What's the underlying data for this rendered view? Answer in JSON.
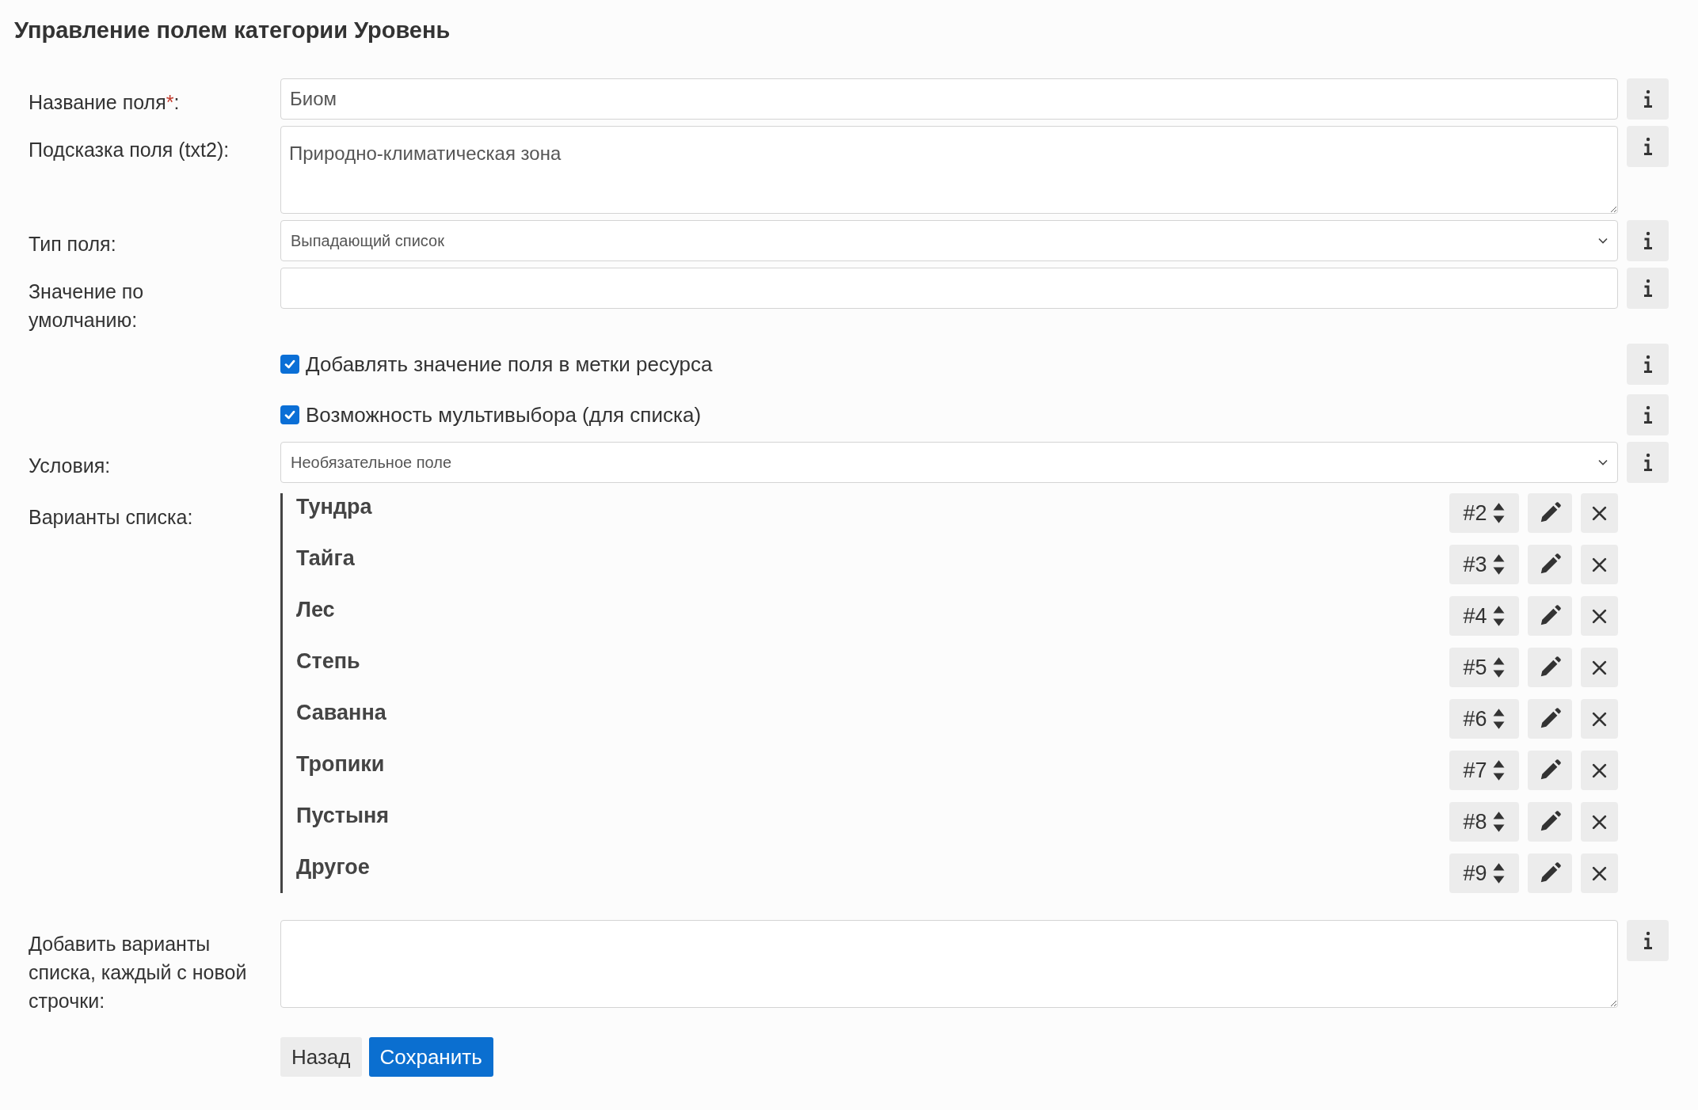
{
  "title": "Управление полем категории Уровень",
  "rows": [
    {
      "kind": "input",
      "label": "Название поля",
      "required_mark": "*",
      "colon": ":",
      "value": "Биом"
    },
    {
      "kind": "textarea",
      "label": "Подсказка поля (txt2):",
      "value": "Природно-климатическая зона"
    },
    {
      "kind": "select",
      "label": "Тип поля:",
      "value": "Выпадающий список"
    },
    {
      "kind": "input",
      "label": "Значение по умолчанию:"
    },
    {
      "kind": "checkbox",
      "text": "Добавлять значение поля в метки ресурса",
      "checked": true
    },
    {
      "kind": "checkbox",
      "text": "Возможность мультивыбора (для списка)",
      "checked": true
    },
    {
      "kind": "select",
      "label": "Условия:",
      "value": "Необязательное поле"
    },
    {
      "kind": "options",
      "label": "Варианты списка:",
      "items": [
        {
          "name": "Тундра",
          "order": "#2"
        },
        {
          "name": "Тайга",
          "order": "#3"
        },
        {
          "name": "Лес",
          "order": "#4"
        },
        {
          "name": "Степь",
          "order": "#5"
        },
        {
          "name": "Саванна",
          "order": "#6"
        },
        {
          "name": "Тропики",
          "order": "#7"
        },
        {
          "name": "Пустыня",
          "order": "#8"
        },
        {
          "name": "Другое",
          "order": "#9"
        }
      ]
    },
    {
      "kind": "textarea",
      "label": "Добавить варианты списка, каждый с новой строчки:"
    }
  ],
  "buttons": [
    {
      "label": "Назад",
      "kind": "secondary"
    },
    {
      "label": "Сохранить",
      "kind": "primary"
    }
  ]
}
